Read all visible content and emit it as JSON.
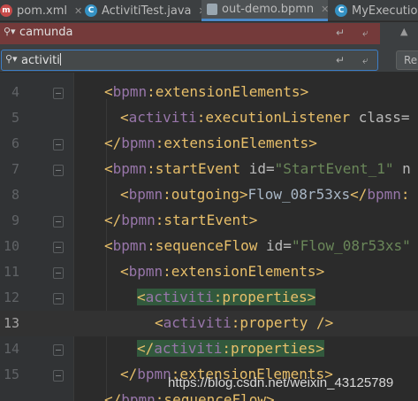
{
  "tabs": [
    {
      "label": "pom.xml",
      "icon": "maven-file-icon",
      "color": "#c54a4a",
      "glyph": "m"
    },
    {
      "label": "ActivitiTest.java",
      "icon": "java-class-icon",
      "color": "#3592c4",
      "glyph": "C"
    },
    {
      "label": "out-demo.bpmn",
      "icon": "bpmn-file-icon",
      "color": "#9aa7b0",
      "glyph": ""
    },
    {
      "label": "MyExecutionL",
      "icon": "java-class-icon",
      "color": "#3592c4",
      "glyph": "C"
    }
  ],
  "active_tab": 2,
  "search": {
    "value": "camunda"
  },
  "replace": {
    "value": "activiti",
    "button_label": "Re"
  },
  "editor": {
    "line_numbers": [
      "4",
      "5",
      "6",
      "7",
      "8",
      "9",
      "10",
      "11",
      "12",
      "13",
      "14",
      "15"
    ],
    "current_line": "13"
  },
  "watermark": "https://blog.csdn.net/weixin_43125789"
}
